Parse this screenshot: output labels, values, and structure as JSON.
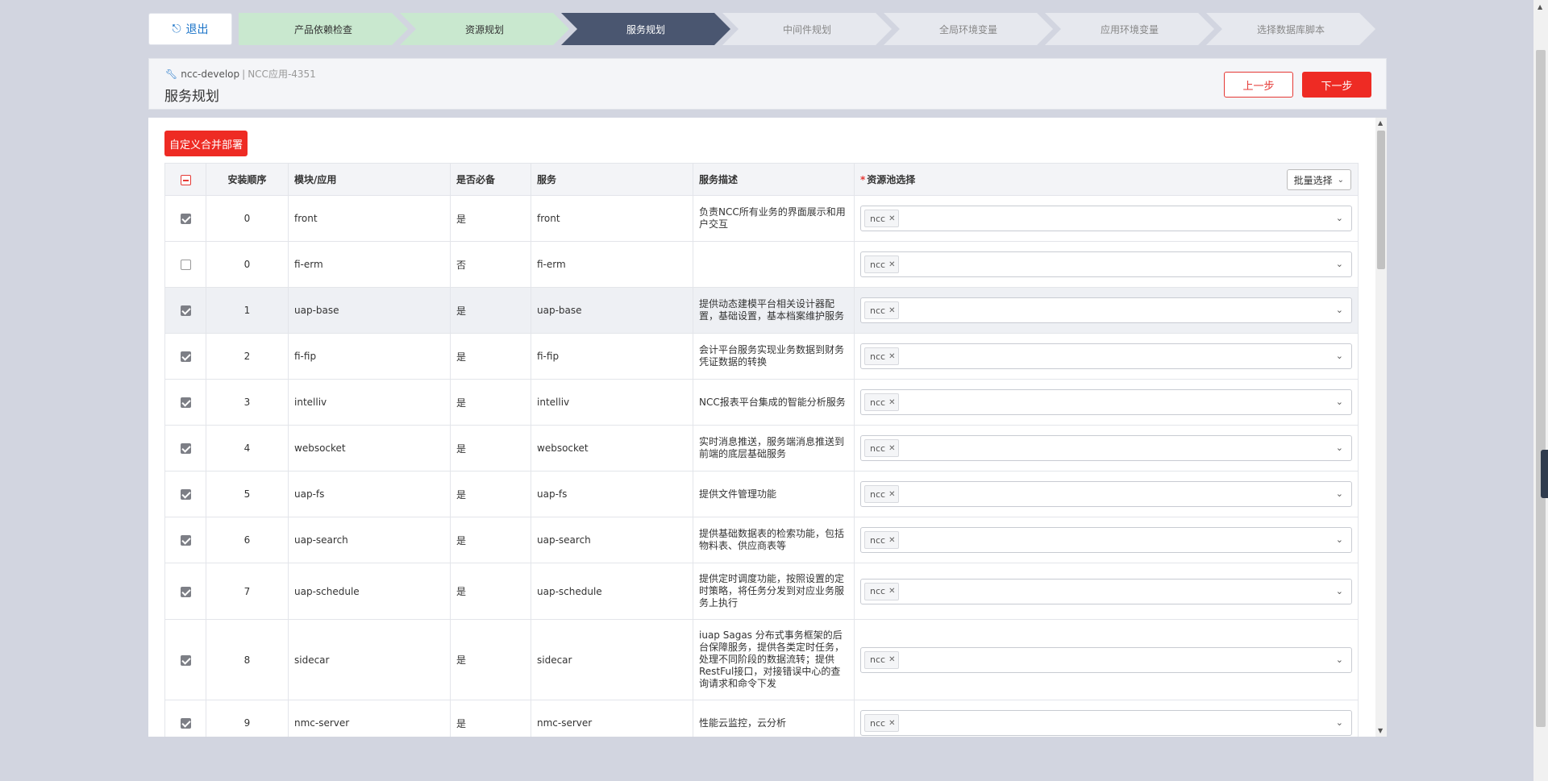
{
  "exit_button": {
    "icon": "logout-icon",
    "label": "退出"
  },
  "steps": [
    {
      "label": "产品依赖检查",
      "state": "done"
    },
    {
      "label": "资源规划",
      "state": "done"
    },
    {
      "label": "服务规划",
      "state": "active"
    },
    {
      "label": "中间件规划",
      "state": "todo"
    },
    {
      "label": "全局环境变量",
      "state": "todo"
    },
    {
      "label": "应用环境变量",
      "state": "todo"
    },
    {
      "label": "选择数据库脚本",
      "state": "todo"
    }
  ],
  "header": {
    "env": "ncc-develop",
    "separator": "|",
    "app": "NCC应用-4351",
    "title": "服务规划",
    "prev_label": "上一步",
    "next_label": "下一步"
  },
  "merge_button": "自定义合并部署",
  "table": {
    "columns": {
      "order": "安装顺序",
      "module": "模块/应用",
      "required": "是否必备",
      "service": "服务",
      "description": "服务描述",
      "pool_required_mark": "*",
      "pool": "资源池选择",
      "batch_select": "批量选择"
    },
    "rows": [
      {
        "checked": true,
        "order": "0",
        "module": "front",
        "required": "是",
        "service": "front",
        "description": "负责NCC所有业务的界面展示和用户交互",
        "pool": "ncc"
      },
      {
        "checked": false,
        "order": "0",
        "module": "fi-erm",
        "required": "否",
        "service": "fi-erm",
        "description": "",
        "pool": "ncc"
      },
      {
        "checked": true,
        "order": "1",
        "module": "uap-base",
        "required": "是",
        "service": "uap-base",
        "description": "提供动态建模平台相关设计器配置，基础设置，基本档案维护服务",
        "pool": "ncc"
      },
      {
        "checked": true,
        "order": "2",
        "module": "fi-fip",
        "required": "是",
        "service": "fi-fip",
        "description": "会计平台服务实现业务数据到财务凭证数据的转换",
        "pool": "ncc"
      },
      {
        "checked": true,
        "order": "3",
        "module": "intelliv",
        "required": "是",
        "service": "intelliv",
        "description": "NCC报表平台集成的智能分析服务",
        "pool": "ncc"
      },
      {
        "checked": true,
        "order": "4",
        "module": "websocket",
        "required": "是",
        "service": "websocket",
        "description": "实时消息推送，服务端消息推送到前端的底层基础服务",
        "pool": "ncc"
      },
      {
        "checked": true,
        "order": "5",
        "module": "uap-fs",
        "required": "是",
        "service": "uap-fs",
        "description": "提供文件管理功能",
        "pool": "ncc"
      },
      {
        "checked": true,
        "order": "6",
        "module": "uap-search",
        "required": "是",
        "service": "uap-search",
        "description": "提供基础数据表的检索功能，包括物料表、供应商表等",
        "pool": "ncc"
      },
      {
        "checked": true,
        "order": "7",
        "module": "uap-schedule",
        "required": "是",
        "service": "uap-schedule",
        "description": "提供定时调度功能，按照设置的定时策略，将任务分发到对应业务服务上执行",
        "pool": "ncc"
      },
      {
        "checked": true,
        "order": "8",
        "module": "sidecar",
        "required": "是",
        "service": "sidecar",
        "description": "iuap Sagas 分布式事务框架的后台保障服务，提供各类定时任务，处理不同阶段的数据流转；提供RestFul接口，对接错误中心的查询请求和命令下发",
        "pool": "ncc"
      },
      {
        "checked": true,
        "order": "9",
        "module": "nmc-server",
        "required": "是",
        "service": "nmc-server",
        "description": "性能云监控，云分析",
        "pool": "ncc"
      }
    ]
  },
  "colors": {
    "accent_red": "#ee2b24",
    "step_done": "#c9e8cf",
    "step_active": "#4a5670",
    "step_todo": "#e6e8ee",
    "link_blue": "#1a73c8"
  }
}
